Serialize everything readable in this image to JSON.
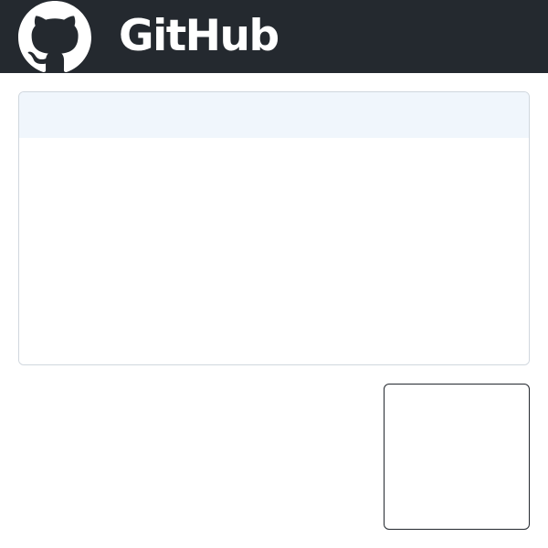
{
  "header": {
    "brand": "GitHub",
    "logo_icon": "github-octocat-icon",
    "background_color": "#24292f",
    "foreground_color": "#ffffff"
  },
  "main_card": {
    "header_color": "#f0f6fc",
    "border_color": "#d0d7de"
  },
  "side_box": {
    "border_color": "#24292f"
  }
}
